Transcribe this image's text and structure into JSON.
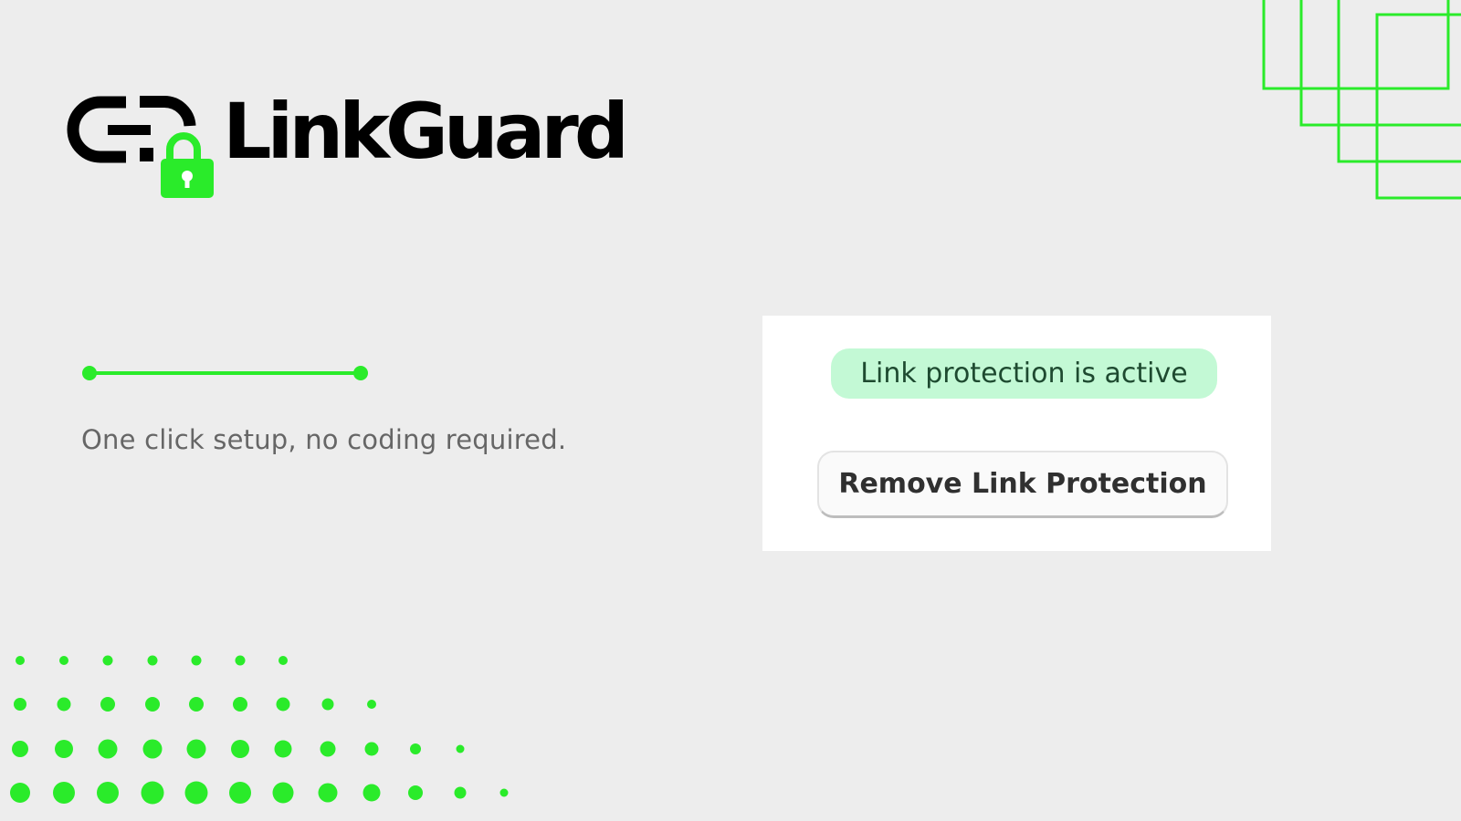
{
  "brand": {
    "name": "LinkGuard",
    "logo_icon": "chain-link-lock-icon"
  },
  "colors": {
    "accent": "#2aeb2a",
    "background": "#ededed",
    "badge_bg": "#c3f9d5",
    "badge_text": "#1e4a30",
    "text_muted": "#666666"
  },
  "tagline": "One click setup, no coding required.",
  "card": {
    "status_badge": "Link protection is active",
    "remove_button_label": "Remove Link Protection"
  },
  "decorations": {
    "top_right": "overlapping-outline-squares",
    "bottom_left": "dot-grid-pattern",
    "divider": "line-with-end-dots"
  }
}
